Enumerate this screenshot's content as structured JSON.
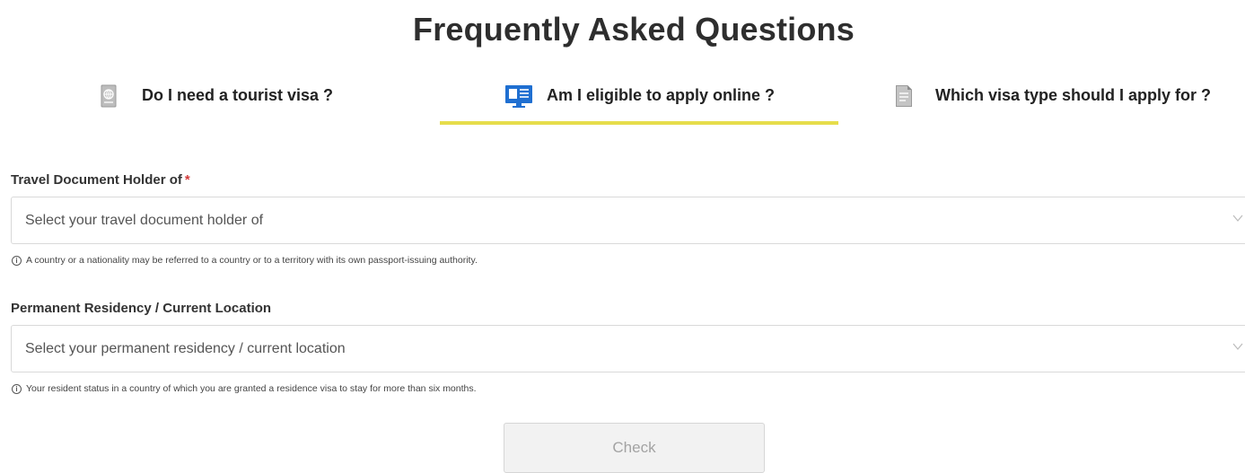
{
  "page": {
    "title": "Frequently Asked Questions"
  },
  "tabs": [
    {
      "label": "Do I need a tourist visa ?",
      "icon": "passport-icon",
      "active": false
    },
    {
      "label": "Am I eligible to apply online ?",
      "icon": "computer-screen-icon",
      "active": true
    },
    {
      "label": "Which visa type should I apply for ?",
      "icon": "document-icon",
      "active": false
    }
  ],
  "form": {
    "travel_document": {
      "label": "Travel Document Holder of",
      "required_mark": "*",
      "placeholder": "Select your travel document holder of",
      "hint": "A country or a nationality may be referred to a country or to a territory with its own passport-issuing authority."
    },
    "residency": {
      "label": "Permanent Residency / Current Location",
      "placeholder": "Select your permanent residency / current location",
      "hint": "Your resident status in a country of which you are granted a residence visa to stay for more than six months."
    },
    "check_label": "Check",
    "info_glyph": "i"
  },
  "colors": {
    "active_tab_underline": "#e6dd4b",
    "required": "#d33b3b",
    "active_icon": "#1f6fd1"
  }
}
